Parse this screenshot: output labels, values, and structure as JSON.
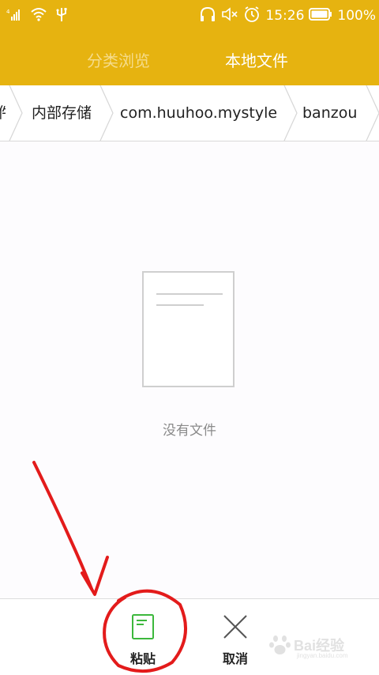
{
  "status_bar": {
    "time": "15:26",
    "battery": "100%",
    "icons": [
      "signal-icon",
      "wifi-icon",
      "usb-icon",
      "headphones-icon",
      "mute-icon",
      "alarm-icon",
      "battery-icon"
    ]
  },
  "tabs": [
    {
      "label": "分类浏览",
      "active": false
    },
    {
      "label": "本地文件",
      "active": true
    }
  ],
  "breadcrumb": {
    "items": [
      "件",
      "内部存储",
      "com.huuhoo.mystyle",
      "banzou"
    ]
  },
  "empty_state": {
    "icon": "document-icon",
    "message": "没有文件"
  },
  "bottom_bar": {
    "paste_label": "粘贴",
    "cancel_label": "取消",
    "paste_icon": "clipboard-icon",
    "cancel_icon": "close-icon"
  },
  "colors": {
    "header": "#e6b310",
    "tab_active": "#ffffff",
    "tab_inactive": "#f5dc8c",
    "paste_icon": "#3cb83c",
    "annotation": "#e31b1b"
  },
  "watermark": {
    "text": "Bai经验",
    "sub": "jingyan.baidu.com"
  }
}
